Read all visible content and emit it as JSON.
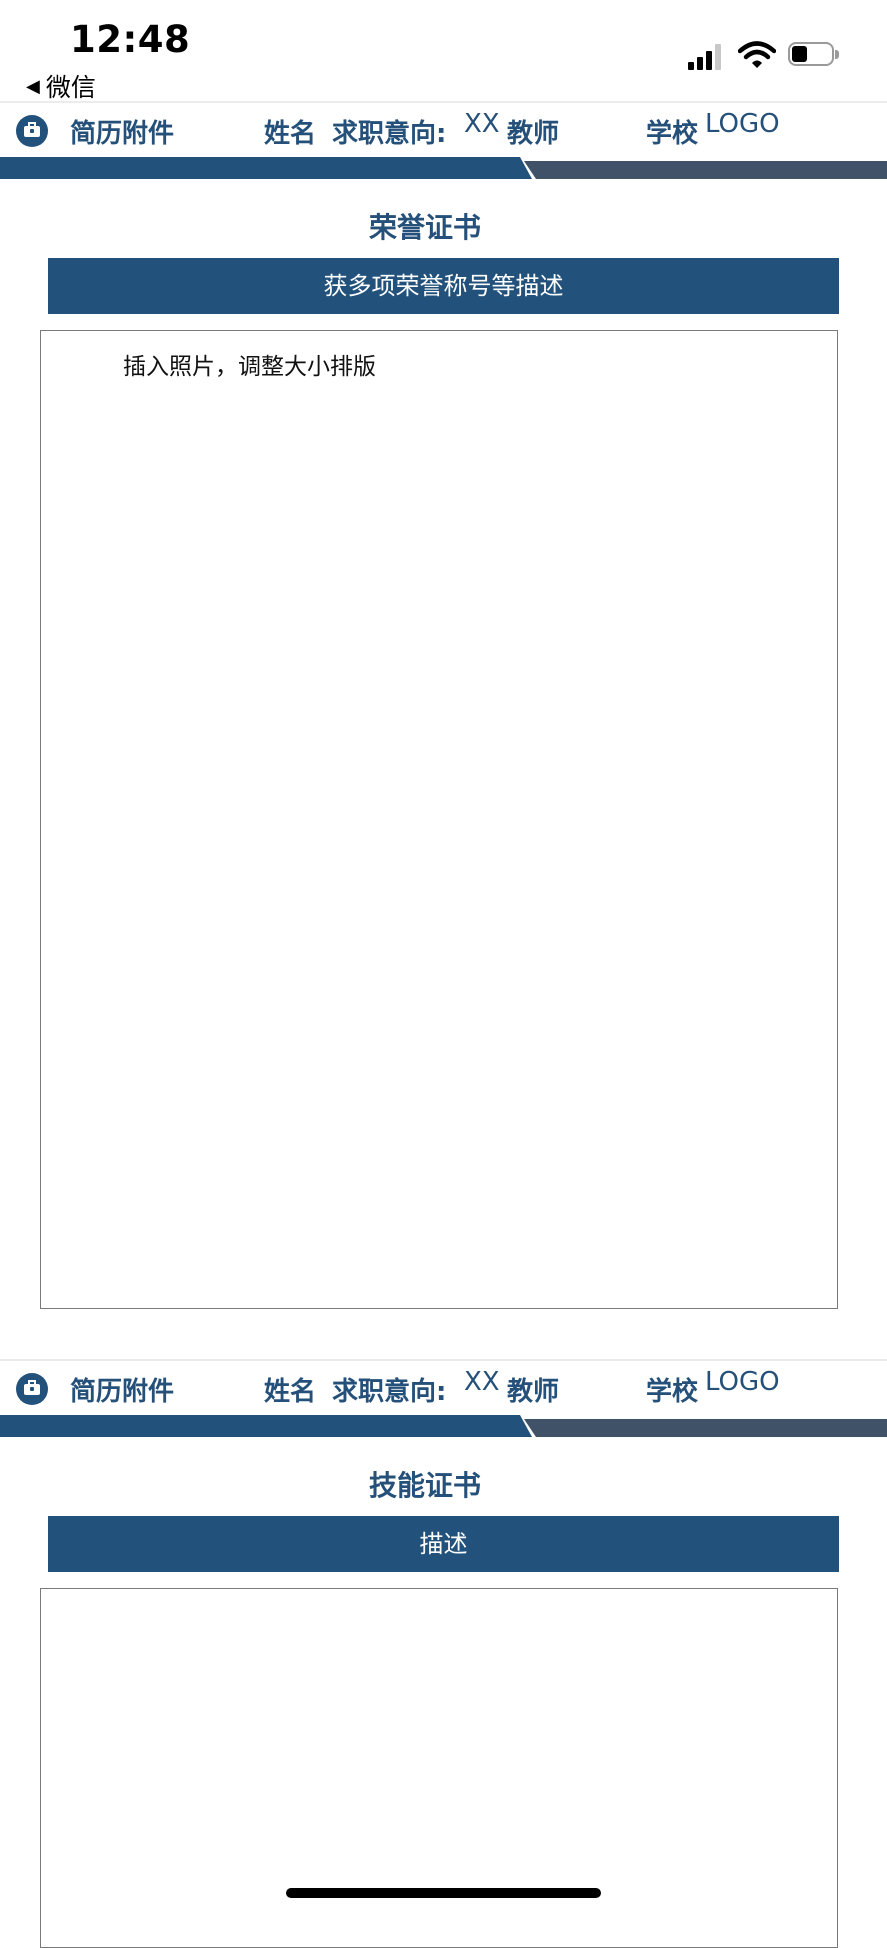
{
  "status_bar": {
    "time": "12:48",
    "back_label": "微信"
  },
  "header": {
    "doc_title": "简历附件",
    "name_label": "姓名",
    "intent_label": "求职意向:",
    "intent_value_xx": "XX",
    "intent_value_role": "教师",
    "school_label": "学校",
    "logo_text": "LOGO"
  },
  "pages": [
    {
      "section_title": "荣誉证书",
      "description": "获多项荣誉称号等描述",
      "frame_text": "插入照片，调整大小排版"
    },
    {
      "section_title": "技能证书",
      "description": "描述",
      "frame_text": ""
    }
  ],
  "colors": {
    "brand_blue": "#22527c",
    "brand_gray": "#3f5268",
    "title_blue": "#25507a"
  },
  "icons": [
    "back-arrow-icon",
    "signal-icon",
    "wifi-icon",
    "battery-icon",
    "briefcase-icon"
  ]
}
